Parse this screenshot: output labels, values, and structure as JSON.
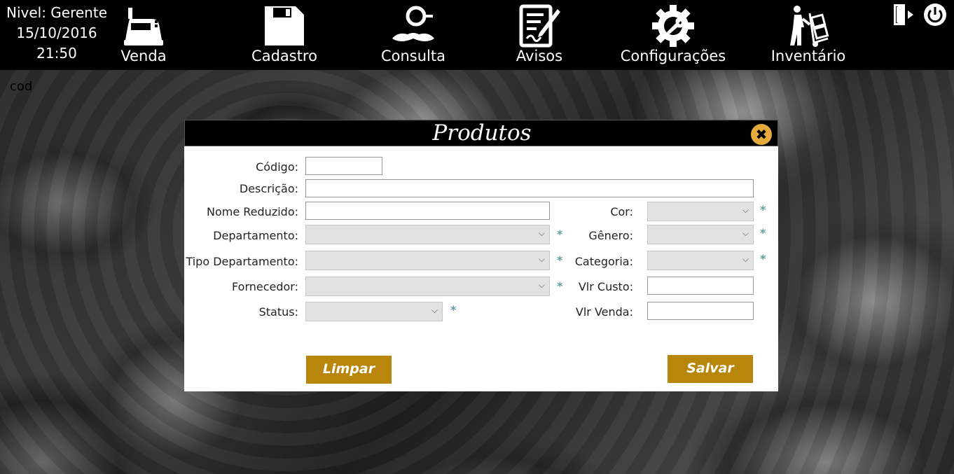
{
  "header": {
    "level": "Nivel: Gerente",
    "date": "15/10/2016",
    "time": "21:50"
  },
  "nav": {
    "venda": {
      "label": "Venda",
      "icon": "cash-register-icon"
    },
    "cadastro": {
      "label": "Cadastro",
      "icon": "floppy-disk-icon"
    },
    "consulta": {
      "label": "Consulta",
      "icon": "detective-icon"
    },
    "avisos": {
      "label": "Avisos",
      "icon": "notepad-pen-icon"
    },
    "configuracoes": {
      "label": "Configurações",
      "icon": "gear-wrench-icon"
    },
    "inventario": {
      "label": "Inventário",
      "icon": "hand-truck-icon"
    }
  },
  "top_right": {
    "logout_icon": "exit-door-icon",
    "power_icon": "power-icon"
  },
  "cod_label": "cod",
  "modal": {
    "title": "Produtos",
    "close_symbol": "✖",
    "labels": {
      "codigo": "Código:",
      "descricao": "Descrição:",
      "nome_reduzido": "Nome Reduzido:",
      "departamento": "Departamento:",
      "tipo_departamento": "Tipo Departamento:",
      "fornecedor": "Fornecedor:",
      "status": "Status:",
      "cor": "Cor:",
      "genero": "Gênero:",
      "categoria": "Categoria:",
      "vlr_custo": "Vlr Custo:",
      "vlr_venda": "Vlr Venda:"
    },
    "values": {
      "codigo": "",
      "descricao": "",
      "nome_reduzido": "",
      "vlr_custo": "",
      "vlr_venda": ""
    },
    "required_mark": "*",
    "buttons": {
      "limpar": "Limpar",
      "salvar": "Salvar"
    }
  },
  "colors": {
    "accent": "#b8860b",
    "close": "#e6a93b",
    "required": "#5f9ea0"
  }
}
